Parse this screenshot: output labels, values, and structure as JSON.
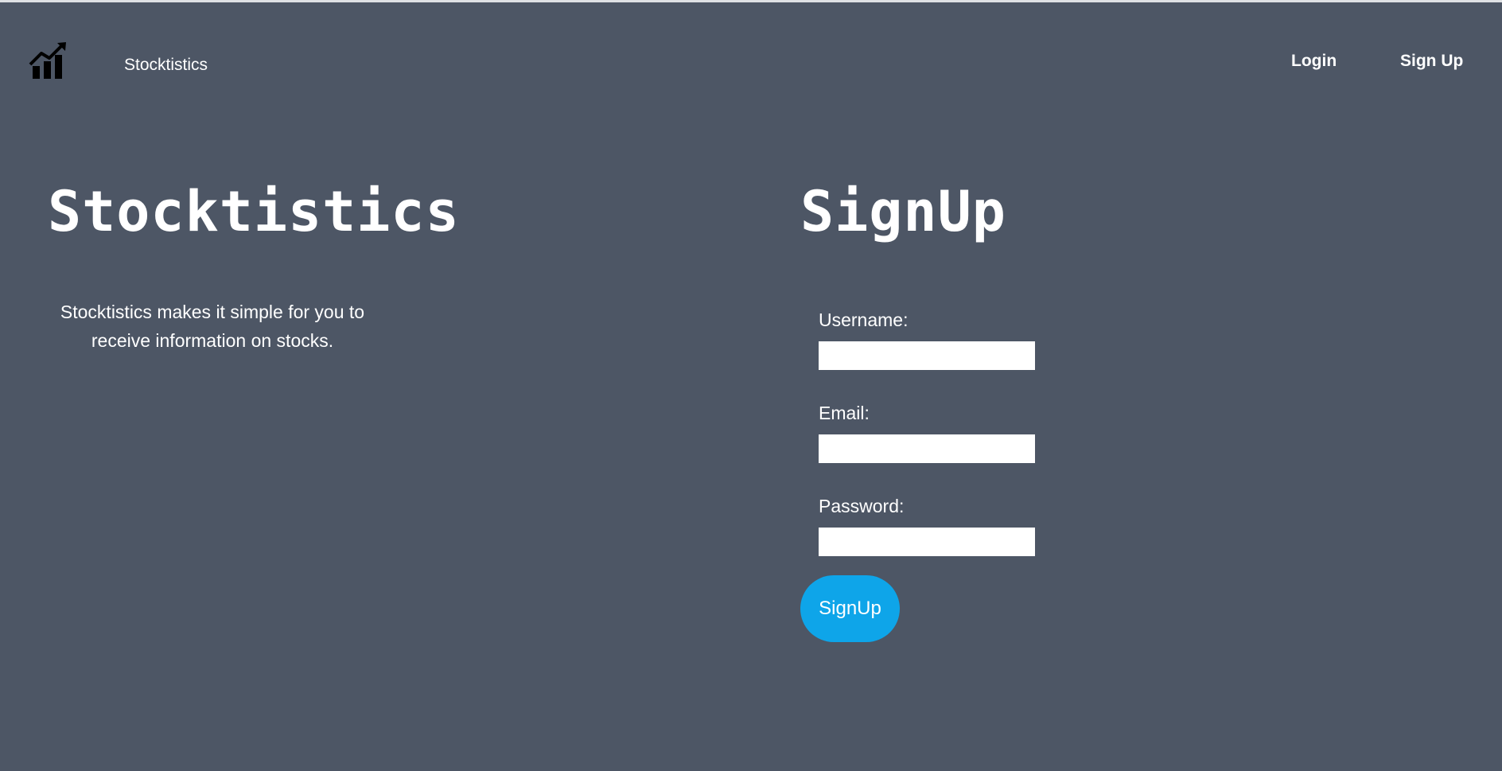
{
  "nav": {
    "brand": "Stocktistics",
    "logo_icon": "chart-growth-icon",
    "login": "Login",
    "signup": "Sign Up"
  },
  "hero": {
    "title": "Stocktistics",
    "description": "Stocktistics makes it simple for you to receive information on stocks."
  },
  "form": {
    "title": "SignUp",
    "username_label": "Username:",
    "username_value": "",
    "email_label": "Email:",
    "email_value": "",
    "password_label": "Password:",
    "password_value": "",
    "submit": "SignUp"
  },
  "colors": {
    "background": "#4d5665",
    "accent": "#0ea5e9",
    "text": "#ffffff"
  }
}
